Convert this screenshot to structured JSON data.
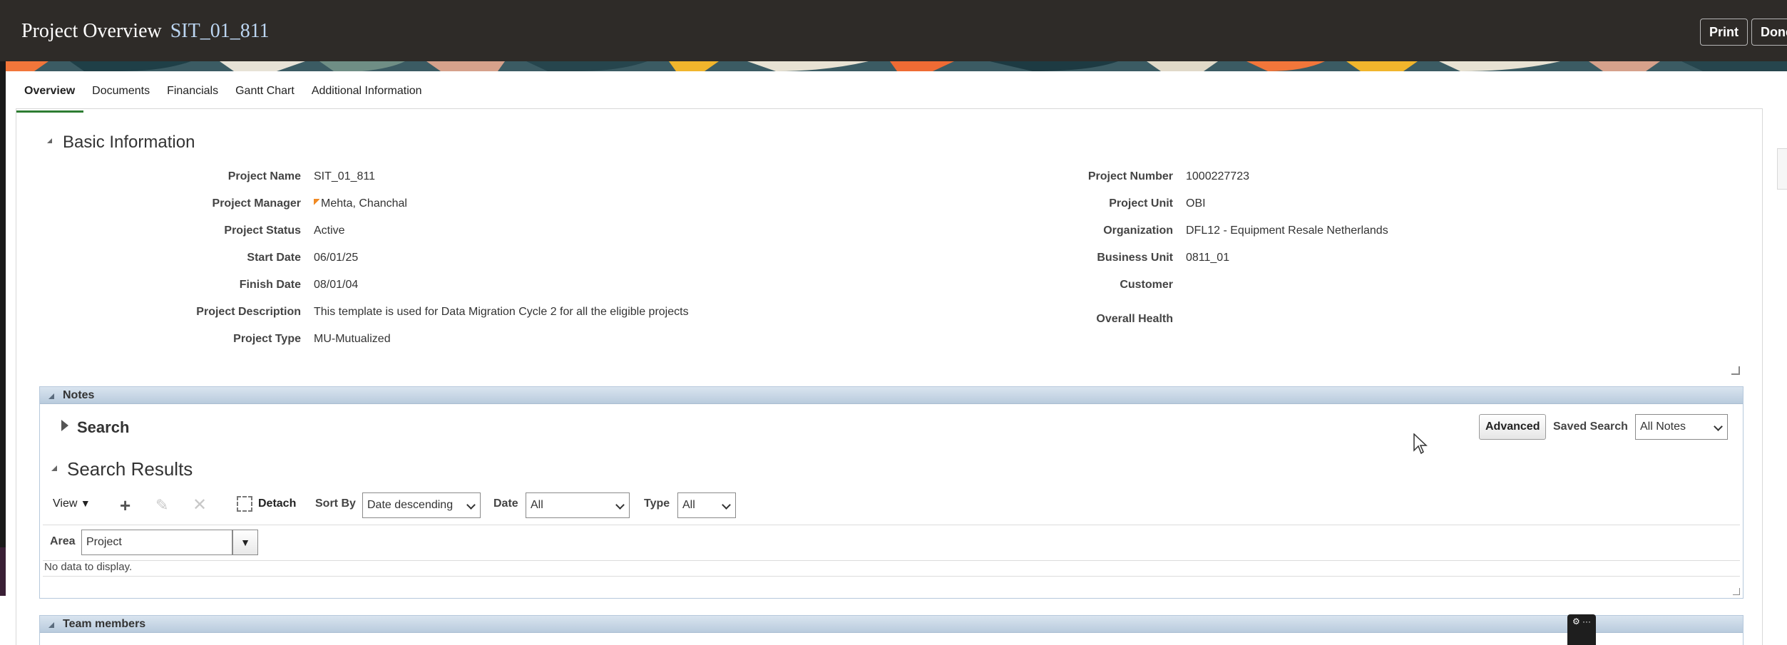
{
  "header": {
    "title": "Project Overview",
    "project_id": "SIT_01_811",
    "print_label": "Print",
    "done_label": "Done"
  },
  "tabs": [
    {
      "label": "Overview",
      "active": true
    },
    {
      "label": "Documents"
    },
    {
      "label": "Financials"
    },
    {
      "label": "Gantt Chart"
    },
    {
      "label": "Additional Information"
    }
  ],
  "basic_info": {
    "title": "Basic Information",
    "left": [
      {
        "label": "Project Name",
        "value": "SIT_01_811"
      },
      {
        "label": "Project Manager",
        "value": "Mehta, Chanchal"
      },
      {
        "label": "Project Status",
        "value": "Active"
      },
      {
        "label": "Start Date",
        "value": "06/01/25"
      },
      {
        "label": "Finish Date",
        "value": "08/01/04"
      },
      {
        "label": "Project Description",
        "value": "This template is used for Data Migration Cycle 2 for all the eligible projects"
      },
      {
        "label": "Project Type",
        "value": "MU-Mutualized"
      }
    ],
    "right": [
      {
        "label": "Project Number",
        "value": "1000227723"
      },
      {
        "label": "Project Unit",
        "value": "OBI"
      },
      {
        "label": "Organization",
        "value": "DFL12 - Equipment Resale Netherlands"
      },
      {
        "label": "Business Unit",
        "value": "0811_01"
      },
      {
        "label": "Customer",
        "value": ""
      },
      {
        "label": "Overall Health",
        "value": ""
      }
    ]
  },
  "notes": {
    "title": "Notes",
    "search_label": "Search",
    "advanced_label": "Advanced",
    "saved_search_label": "Saved Search",
    "saved_search_value": "All Notes",
    "results_title": "Search Results",
    "toolbar": {
      "view_label": "View",
      "detach_label": "Detach",
      "sort_by_label": "Sort By",
      "sort_by_value": "Date descending",
      "date_label": "Date",
      "date_value": "All",
      "type_label": "Type",
      "type_value": "All"
    },
    "area_label": "Area",
    "area_value": "Project",
    "empty_text": "No data to display."
  },
  "team": {
    "title": "Team members"
  },
  "colors": {
    "header_bg": "#2e2b28",
    "project_id": "#bcd6f2",
    "active_tab": "#2e7d32",
    "panel_header": "#c8d7e6"
  }
}
